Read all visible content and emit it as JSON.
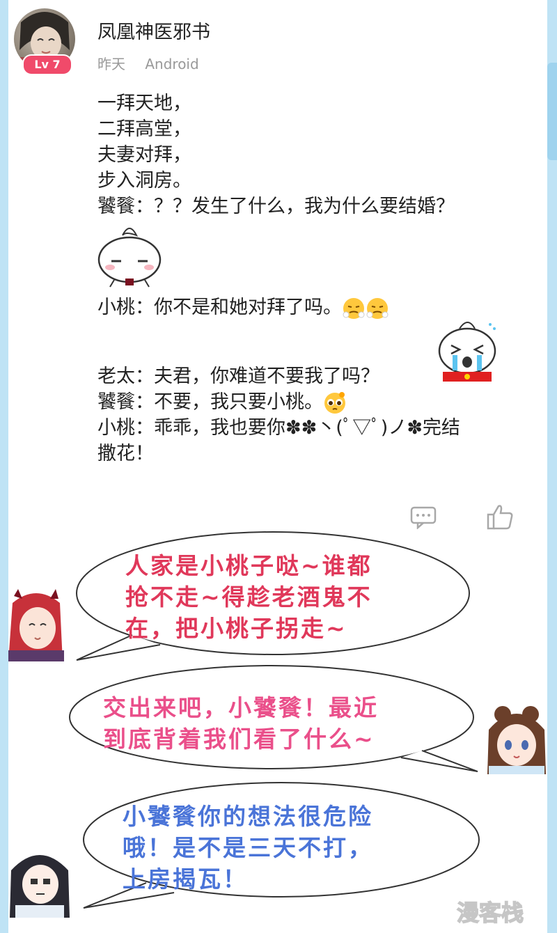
{
  "post": {
    "username": "凤凰神医邪书",
    "level": "Lv 7",
    "time": "昨天",
    "device": "Android",
    "lines": [
      "一拜天地，",
      "二拜高堂，",
      "夫妻对拜，",
      "步入洞房。",
      "饕餮：？？发生了什么，我为什么要结婚？",
      "小桃：你不是和她对拜了吗。",
      "老太：夫君，你难道不要我了吗？",
      "饕餮：不要，我只要小桃。",
      "小桃：乖乖，我也要你✽✽丶(ﾟ▽ﾟ)ノ✽完结",
      "撒花！"
    ],
    "emoji_names": [
      "steam-face-emoji",
      "steam-face-emoji",
      "pleading-face-emoji"
    ]
  },
  "actions": {
    "comment_icon": "comment-icon",
    "like_icon": "thumbs-up-icon"
  },
  "bubbles": [
    {
      "lines": [
        "人家是小桃子哒~谁都",
        "抢不走~得趁老酒鬼不",
        "在，把小桃子拐走~"
      ],
      "color": "#e0385a"
    },
    {
      "lines": [
        "交出来吧，小饕餮！最近",
        "到底背着我们看了什么~"
      ],
      "color": "#ea4f8a"
    },
    {
      "lines": [
        "小饕餮你的想法很危险",
        "哦！是不是三天不打，",
        "上房揭瓦！"
      ],
      "color": "#4a74d8"
    }
  ],
  "watermark": "漫客栈",
  "colors": {
    "frame": "#bfe3f5",
    "badge": "#f04a6a",
    "meta": "#999999"
  }
}
